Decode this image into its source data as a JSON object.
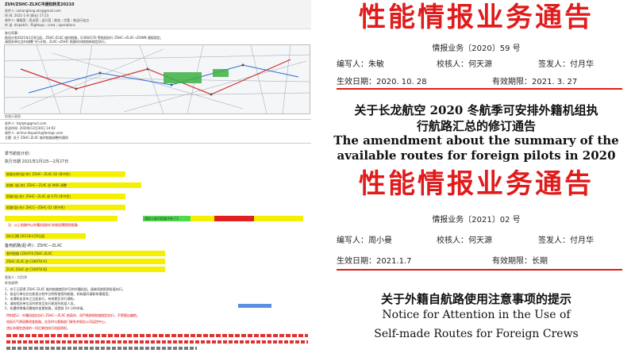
{
  "left": {
    "email_subject": "ZUH/ZSHC-ZLXC冲通知转发20210",
    "header_lines": [
      "发件人: zuhangtong.atc@gmail.com",
      "时 间: 2021-1-8 (周五) 17:23",
      "收件人: 情报室 ; 签派室 ; 运行室 ; 航务 ; 空管 ; 各运行站点",
      "抄 送: dispatch ; flightops ; crew ; operations"
    ],
    "greeting": "各位同事：",
    "intro_lines": [
      "航班计划2021年1月8日起，ZSHC-ZLXC 临时航路，G366/G70 等航段执行 ZSHC→ZLXC→ZXWN 通报规定。",
      "请相关单位及时调整飞行计划，ZLXC→ZSHC 航路时间按照新规定执行。"
    ],
    "chart_caption": "航路示意图",
    "section2_meta": [
      "发件人: hzjdyk@gmail.com",
      "发送时间: 2020年12月30日 14:02",
      "收件人: airline-dispatch@foreign.com",
      "主题: 关于 ZSHC-ZLXC 临时航路调整的通知"
    ],
    "season_line": "季节航班计划：",
    "period_line": "执行日期 2021年1月1日—2月27日",
    "yellow_rows": [
      "航路名称/(起-终): ZSHC—ZLXC-02 (季节性)",
      "航路/ (起-终): ZSHC—ZLXC 经 W66 调整",
      "航路/(起-终): ZSHC—ZLXC 经 G70 (季节性)",
      "航路/(起-终): ZHCC—ZSHC-02 (季节性)"
    ],
    "green_text": "通航与临时航路冲突 C3",
    "red_note": "注：以上航路中以外籍机组执行的航班需提前报备",
    "date_line": "执行日期 2021年1月9日起",
    "flight_header": "备用航路(起-终)：ZSHC—ZLXC",
    "flight_rows": [
      "临时航路 CDG978 ZSHC-ZLXC",
      "ZSHC-ZLXC 经 CSK978 A1",
      "ZLXC-ZSHC 经 CSX978 B2"
    ],
    "signature": "签发人：付月华",
    "notes_header": "补充说明：",
    "notes": [
      "1、对于已获得 ZSHC-ZLXC 临时航路使用许可的外籍机组，请继续按照原批复执行。",
      "2、各运行单位应在航班计划中注明所使用的航路，如有疑问请联系情报室。",
      "3、本通知自发布之日起执行，有效期至另行通知。",
      "4、请各相关单位及时转发至执行航班的机组人员。",
      "5、如遇特殊情况需临时变更航路，须提前 24 小时申请。"
    ],
    "red_lines": [
      "特别提示：外籍机组在执行 ZSHC—ZLXC 航段时，须严格按照航路规定执行，不得擅自偏航。",
      "如因天气原因需改变航路，应及时与管制部门联系并报告公司运控中心。",
      "违反本规定造成的一切后果由执行机组承担。"
    ]
  },
  "notice1": {
    "title": "性能情报业务通告",
    "number": "情报业务〔2020〕59 号",
    "author_label": "编写人：",
    "author": "朱敏",
    "reviewer_label": "校核人：",
    "reviewer": "何天源",
    "signer_label": "签发人：",
    "signer": "付月华",
    "effective_label": "生效日期：",
    "effective_date": "2020. 10. 28",
    "validity_label": "有效期限：",
    "validity": "2021. 3. 27",
    "heading_cn_line1": "关于长龙航空 2020 冬航季可安排外籍机组执",
    "heading_cn_line2": "行航路汇总的修订通告",
    "heading_en_line1": "The amendment about the summary of the",
    "heading_en_line2": "available routes for foreign pilots in 2020"
  },
  "notice2": {
    "title": "性能情报业务通告",
    "number": "情报业务〔2021〕02 号",
    "author_label": "编写人：",
    "author": "周小曼",
    "reviewer_label": "校核人：",
    "reviewer": "何天源",
    "signer_label": "签发人：",
    "signer": "付月华",
    "effective_label": "生效日期：",
    "effective_date": "2021.1.7",
    "validity_label": "有效期限：",
    "validity": "长期",
    "heading_cn": "关于外籍自航路使用注意事项的提示",
    "heading_en_line1": "Notice for Attention in the Use of",
    "heading_en_line2": "Self-made Routes for Foreign Crews"
  }
}
